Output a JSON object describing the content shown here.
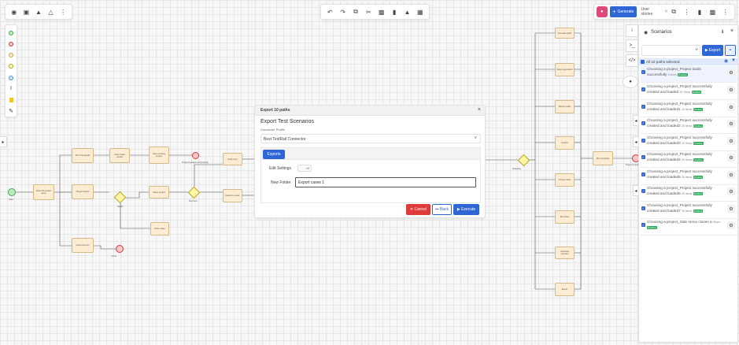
{
  "top_toolbar_left": {
    "icons": [
      "globe-icon",
      "save-icon",
      "upload-icon",
      "flask-icon",
      "more-vertical-icon"
    ]
  },
  "top_toolbar_center": {
    "icons": [
      "undo-icon",
      "redo-icon",
      "copy-icon",
      "cut-icon",
      "paste-icon",
      "delete-icon",
      "align-icon",
      "layout-icon"
    ]
  },
  "top_toolbar_right": {
    "generate_label": "Generate",
    "user_stories_label": "User stories",
    "icons": [
      "copy-icon",
      "more-vertical-icon",
      "chat-icon",
      "comments-icon",
      "more-vertical-icon"
    ]
  },
  "palette": {
    "icons": [
      "start-event-icon",
      "end-event-icon",
      "intermediate-event-icon",
      "gateway-icon",
      "task-icon",
      "text-cursor-icon",
      "data-object-icon",
      "pen-icon"
    ]
  },
  "diagram": {
    "tasks": [
      "Enter the project name",
      "Fill in the details",
      "Click create project",
      "Open existing project",
      "Project loaded",
      "Select project",
      "Click create",
      "Verify error",
      "Failed to create",
      "Check the form",
      "Generate paths",
      "Select generation",
      "Review paths",
      "Confirm",
      "Choose Tests",
      "Run Tests",
      "Generate scenario",
      "Export",
      "Run scenarios",
      "Open project",
      "Export",
      "Done",
      "Run",
      "Save",
      "Close",
      "Open Test Results"
    ],
    "events": {
      "start": "Start",
      "end_1": "Project loaded successfully",
      "end_2": "Error",
      "end_3": "Project loaded"
    },
    "gateways": [
      "Valid?",
      "Decision",
      "Gateway"
    ]
  },
  "modal": {
    "header": "Export 10 paths",
    "close": "×",
    "title": "Export Test Scenarios",
    "connector_label": "Connector Profile",
    "connector_value": "Best TestRail Connector",
    "tab_exports": "Exports",
    "edit_settings_label": "Edit Settings",
    "edit_settings_value": "off",
    "new_folder_label": "New Folder",
    "new_folder_value": "Export cases 1",
    "cancel": "✕ Cancel",
    "back": "⏮ Back",
    "execute": "▶ Execute"
  },
  "side_tabs": {
    "info": "i",
    "terminal": ">_",
    "code": "</>",
    "eye": "●"
  },
  "scenarios_panel": {
    "title": "Scenarios",
    "export_label": "Export",
    "select_all_label": "All 10 paths selected.",
    "items": [
      {
        "text": "Choosing a project_Project loads successfully",
        "meta": "4 items",
        "tag": "Positive"
      },
      {
        "text": "Choosing a project_Project successfully created and loaded",
        "meta": "26 Steps",
        "tag": "Positive"
      },
      {
        "text": "Choosing a project_Project successfully created and loaded1",
        "meta": "26 items",
        "tag": "Positive"
      },
      {
        "text": "Choosing a project_Project successfully created and loaded2",
        "meta": "26 items",
        "tag": "Positive"
      },
      {
        "text": "Choosing a project_Project successfully created and loaded3",
        "meta": "26 Steps",
        "tag": "Positive"
      },
      {
        "text": "Choosing a project_Project successfully created and loaded4",
        "meta": "26 Steps",
        "tag": "Positive"
      },
      {
        "text": "Choosing a project_Project successfully created and loaded5",
        "meta": "26 items",
        "tag": "Positive"
      },
      {
        "text": "Choosing a project_Project successfully created and loaded6",
        "meta": "26 items",
        "tag": "Positive"
      },
      {
        "text": "Choosing a project_Project successfully created and loaded7",
        "meta": "26 items",
        "tag": "Positive"
      },
      {
        "text": "Choosing a project_Side menu closes a",
        "meta": "Steps",
        "tag": "Positive"
      }
    ]
  },
  "colors": {
    "accent": "#2f66d6",
    "cancel": "#e03b3b",
    "positive": "#2faa5a",
    "task_fill": "#fcecd2",
    "gateway_fill": "#fff7a8"
  }
}
